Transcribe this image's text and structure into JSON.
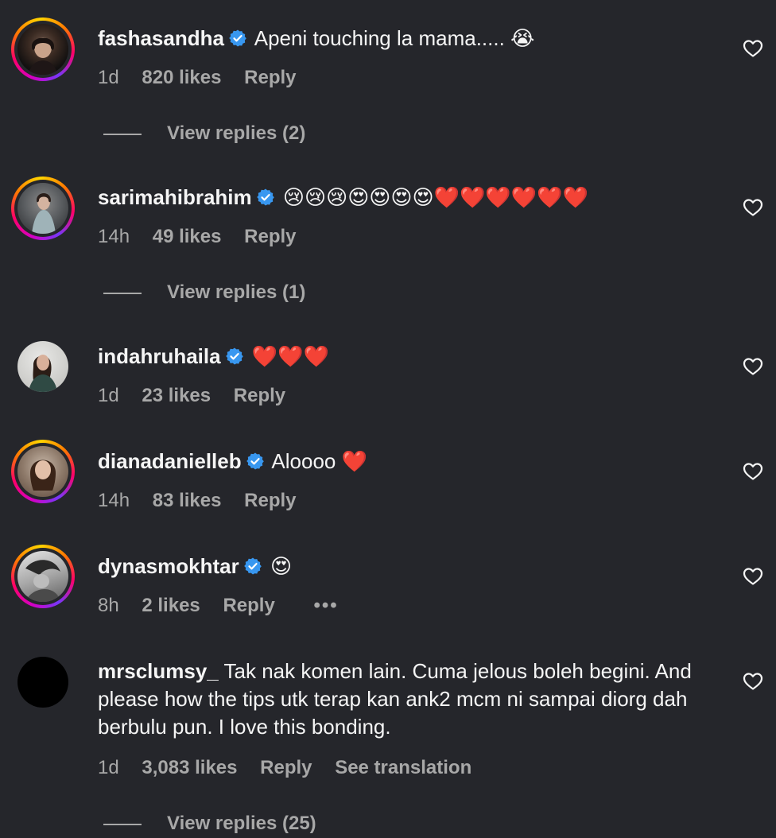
{
  "comments": [
    {
      "username": "fashasandha",
      "verified": true,
      "text": "Apeni touching la mama..... 😭",
      "time": "1d",
      "likes": "820 likes",
      "reply_label": "Reply",
      "view_replies": "View replies (2)",
      "avatar_ring": true
    },
    {
      "username": "sarimahibrahim",
      "verified": true,
      "text": "😢😢😢😍😍😍😍❤️❤️❤️❤️❤️❤️",
      "time": "14h",
      "likes": "49 likes",
      "reply_label": "Reply",
      "view_replies": "View replies (1)",
      "avatar_ring": true
    },
    {
      "username": "indahruhaila",
      "verified": true,
      "text": "❤️❤️❤️",
      "time": "1d",
      "likes": "23 likes",
      "reply_label": "Reply",
      "avatar_ring": false
    },
    {
      "username": "dianadanielleb",
      "verified": true,
      "text": "Aloooo ❤️",
      "time": "14h",
      "likes": "83 likes",
      "reply_label": "Reply",
      "avatar_ring": true
    },
    {
      "username": "dynasmokhtar",
      "verified": true,
      "text": "😍",
      "time": "8h",
      "likes": "2 likes",
      "reply_label": "Reply",
      "more_label": "•••",
      "avatar_ring": true
    },
    {
      "username": "mrsclumsy_",
      "verified": false,
      "text": "Tak nak komen lain. Cuma jelous boleh begini. And please how the tips utk terap kan ank2 mcm ni sampai diorg dah berbulu pun. I love this bonding.",
      "time": "1d",
      "likes": "3,083 likes",
      "reply_label": "Reply",
      "translation_label": "See translation",
      "view_replies": "View replies (25)",
      "avatar_ring": false
    }
  ],
  "colors": {
    "background": "#25262b",
    "text": "#f5f5f5",
    "muted": "#a8a8a8",
    "verified_blue": "#0095f6"
  },
  "icons": {
    "like": "heart-outline-icon",
    "verified": "verified-badge-icon",
    "more": "more-options-icon"
  }
}
